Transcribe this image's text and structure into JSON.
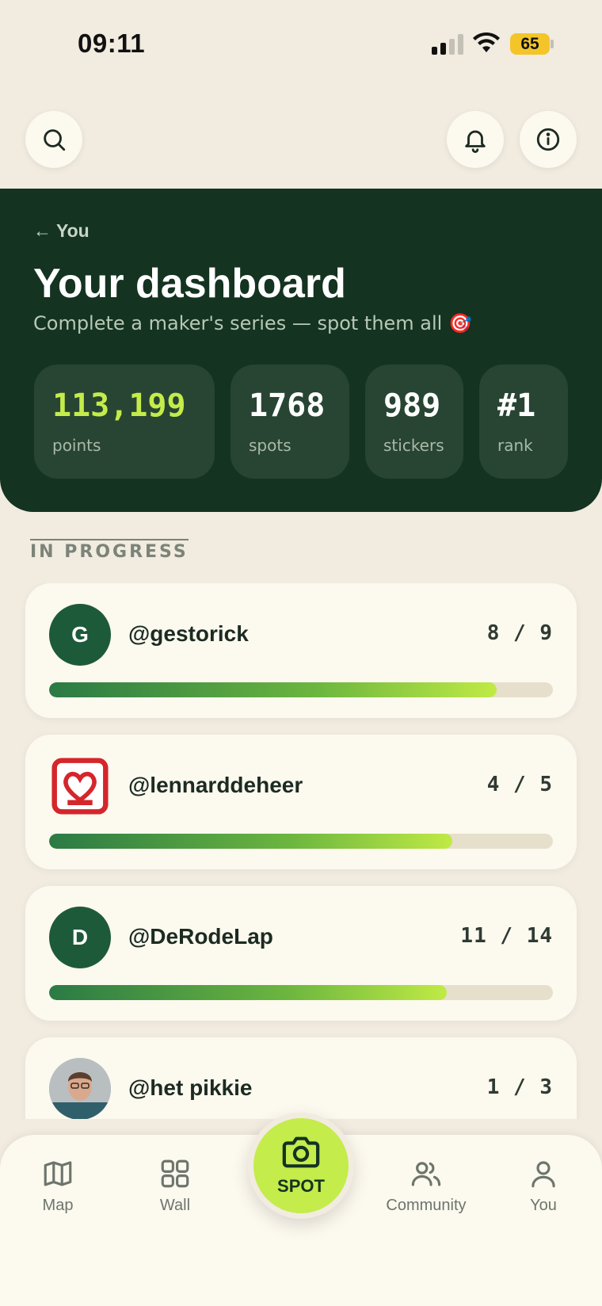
{
  "status_bar": {
    "time": "09:11",
    "battery": "65"
  },
  "header": {
    "back_label": "← You",
    "title": "Your dashboard",
    "subtitle": "Complete a maker's series — spot them all 🎯"
  },
  "stats": [
    {
      "value": "113,199",
      "label": "points"
    },
    {
      "value": "1768",
      "label": "spots"
    },
    {
      "value": "989",
      "label": "stickers"
    },
    {
      "value": "#1",
      "label": "rank"
    }
  ],
  "section_title": "IN PROGRESS",
  "series": [
    {
      "initial": "G",
      "handle": "@gestorick",
      "count": "8 / 9",
      "progress": 0.889
    },
    {
      "initial": "",
      "handle": "@lennarddeheer",
      "count": "4 / 5",
      "progress": 0.8
    },
    {
      "initial": "D",
      "handle": "@DeRodeLap",
      "count": "11 / 14",
      "progress": 0.79
    },
    {
      "initial": "",
      "handle": "@het pikkie",
      "count": "1 / 3",
      "progress": 0.333
    }
  ],
  "nav": {
    "map": "Map",
    "wall": "Wall",
    "spot": "SPOT",
    "community": "Community",
    "you": "You"
  },
  "colors": {
    "background": "#f1ebe0",
    "hero": "#143321",
    "accent": "#c4ec4a",
    "card": "#fcf9ef"
  }
}
